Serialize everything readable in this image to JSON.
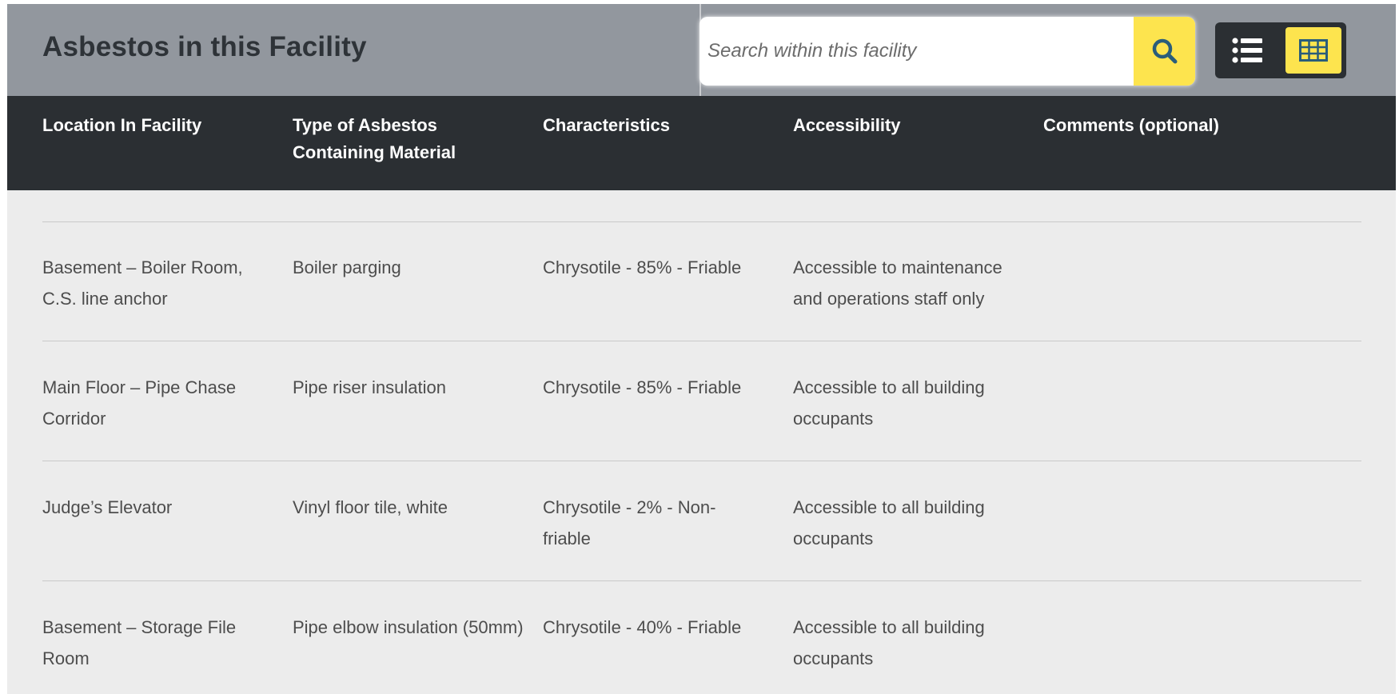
{
  "header": {
    "title": "Asbestos in this Facility",
    "search": {
      "placeholder": "Search within this facility",
      "value": ""
    },
    "icons": {
      "search": "search-icon",
      "list_view": "list-icon",
      "table_view": "table-icon"
    },
    "active_view": "table"
  },
  "table": {
    "columns": [
      "Location In Facility",
      "Type of Asbestos Containing Material",
      "Characteristics",
      "Accessibility",
      "Comments (optional)"
    ],
    "rows": [
      [
        "Basement – Boiler Room, C.S. line anchor",
        "Boiler parging",
        "Chrysotile - 85% - Friable",
        "Accessible to maintenance and operations staff only",
        ""
      ],
      [
        "Main Floor – Pipe Chase Corridor",
        "Pipe riser insulation",
        "Chrysotile - 85% - Friable",
        "Accessible to all building occupants",
        ""
      ],
      [
        "Judge’s Elevator",
        "Vinyl floor tile, white",
        "Chrysotile - 2% - Non-friable",
        "Accessible to all building occupants",
        ""
      ],
      [
        "Basement – Storage File Room",
        "Pipe elbow insulation (50mm)",
        "Chrysotile - 40% - Friable",
        "Accessible to all building occupants",
        ""
      ]
    ]
  },
  "colors": {
    "header_bg": "#92979e",
    "table_header_bg": "#2b2f33",
    "accent_yellow": "#fde44e",
    "body_bg": "#ececec"
  }
}
